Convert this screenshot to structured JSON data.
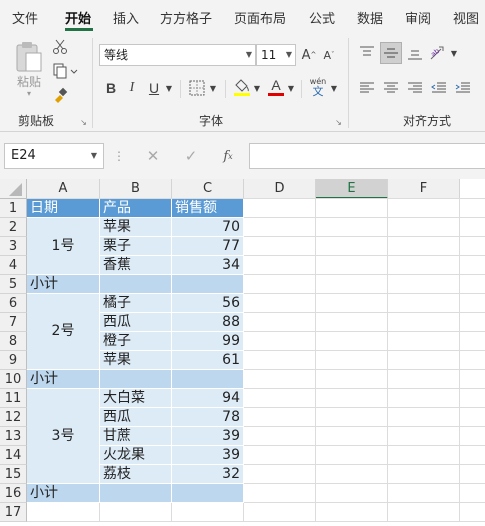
{
  "tabs": [
    "文件",
    "开始",
    "插入",
    "方方格子",
    "页面布局",
    "公式",
    "数据",
    "审阅",
    "视图"
  ],
  "ribbon": {
    "clipboard": {
      "group_label": "剪贴板",
      "paste_label": "粘贴"
    },
    "font": {
      "group_label": "字体",
      "font_name": "等线",
      "font_size": "11",
      "grow": "A",
      "shrink": "A",
      "bold": "B",
      "italic": "I",
      "underline": "U",
      "font_color_letter": "A",
      "font_color": "#e00000",
      "phonetic_top": "wén",
      "phonetic_bottom": "文"
    },
    "alignment": {
      "group_label": "对齐方式"
    }
  },
  "formula_bar": {
    "name_box": "E24",
    "formula": ""
  },
  "columns": [
    "A",
    "B",
    "C",
    "D",
    "E",
    "F"
  ],
  "selected_column": "E",
  "rows": [
    "1",
    "2",
    "3",
    "4",
    "5",
    "6",
    "7",
    "8",
    "9",
    "10",
    "11",
    "12",
    "13",
    "14",
    "15",
    "16",
    "17"
  ],
  "header_row": {
    "a": "日期",
    "b": "产品",
    "c": "销售额"
  },
  "groups": [
    {
      "date": "1号",
      "items": [
        {
          "product": "苹果",
          "sales": "70"
        },
        {
          "product": "栗子",
          "sales": "77"
        },
        {
          "product": "香蕉",
          "sales": "34"
        }
      ]
    },
    {
      "date": "2号",
      "items": [
        {
          "product": "橘子",
          "sales": "56"
        },
        {
          "product": "西瓜",
          "sales": "88"
        },
        {
          "product": "橙子",
          "sales": "99"
        },
        {
          "product": "苹果",
          "sales": "61"
        }
      ]
    },
    {
      "date": "3号",
      "items": [
        {
          "product": "大白菜",
          "sales": "94"
        },
        {
          "product": "西瓜",
          "sales": "78"
        },
        {
          "product": "甘蔗",
          "sales": "39"
        },
        {
          "product": "火龙果",
          "sales": "39"
        },
        {
          "product": "荔枝",
          "sales": "32"
        }
      ]
    }
  ],
  "subtotal_label": "小计",
  "colors": {
    "accent": "#217346",
    "header_fill": "#5b9bd5",
    "data_fill": "#ddebf7",
    "subtotal_fill": "#bdd7ee"
  }
}
